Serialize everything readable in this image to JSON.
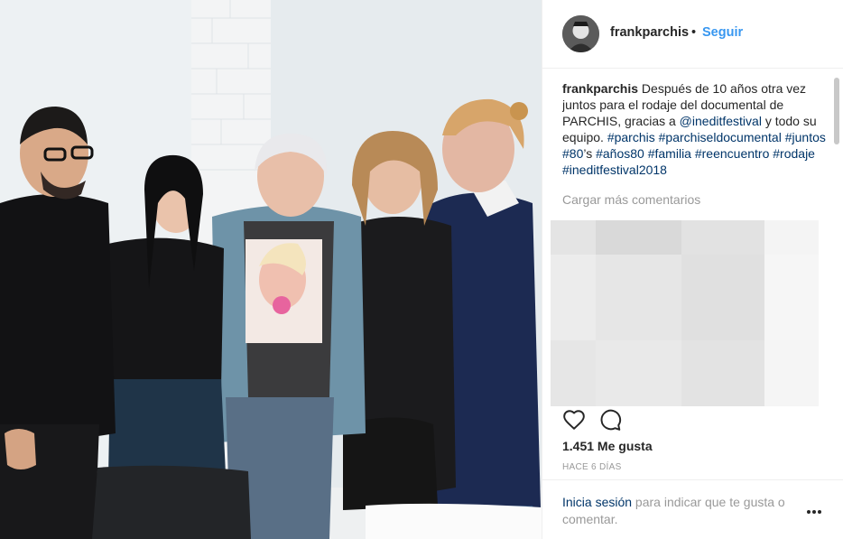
{
  "post": {
    "username": "frankparchis",
    "dot": "•",
    "follow_label": "Seguir",
    "caption_user": "frankparchis",
    "caption_text_1": " Después de 10 años otra vez juntos para el rodaje del documental de PARCHIS, gracias a ",
    "mention": "@ineditfestival",
    "caption_text_2": " y todo su equipo. ",
    "hashtags": [
      "#parchis",
      "#parchiseldocumental",
      "#juntos",
      "#80",
      "#años80",
      "#familia",
      "#reencuentro",
      "#rodaje",
      "#ineditfestival2018"
    ],
    "apostrophe_s": "’s",
    "load_more": "Cargar más comentarios",
    "likes": "1.451 Me gusta",
    "timestamp": "HACE 6 DÍAS"
  },
  "footer": {
    "login_link": "Inicia sesión",
    "login_rest": " para indicar que te gusta o comentar."
  },
  "icons": {
    "like": "heart-icon",
    "comment": "comment-icon",
    "more": "more-options-icon"
  },
  "colors": {
    "link_blue": "#003569",
    "follow_blue": "#3897f0",
    "muted_gray": "#999999",
    "text": "#262626"
  }
}
